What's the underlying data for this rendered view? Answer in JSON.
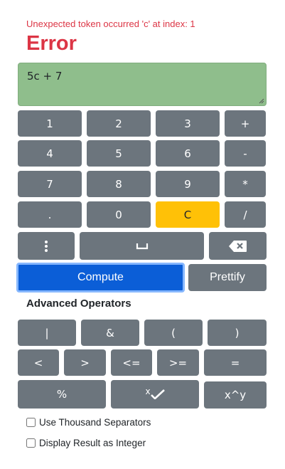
{
  "error": {
    "message": "Unexpected token occurred 'c' at index: 1",
    "title": "Error"
  },
  "expression": {
    "value": "5c + 7"
  },
  "keypad": {
    "row1": [
      "1",
      "2",
      "3",
      "+"
    ],
    "row2": [
      "4",
      "5",
      "6",
      "-"
    ],
    "row3": [
      "7",
      "8",
      "9",
      "*"
    ],
    "row4": [
      ".",
      "0",
      "C",
      "/"
    ],
    "row5_icons": [
      "more-vertical-icon",
      "space-bar-icon",
      "backspace-icon"
    ]
  },
  "actions": {
    "compute": "Compute",
    "prettify": "Prettify"
  },
  "advanced": {
    "title": "Advanced Operators",
    "row1": [
      "|",
      "&",
      "(",
      ")"
    ],
    "row2": [
      "<",
      ">",
      "<=",
      ">=",
      "="
    ],
    "row3": [
      "%",
      "x",
      "x^y"
    ],
    "root_icon": "root-check-icon"
  },
  "options": {
    "thousand_separators": {
      "label": "Use Thousand Separators",
      "checked": false
    },
    "integer_result": {
      "label": "Display Result as Integer",
      "checked": false
    }
  },
  "colors": {
    "error": "#dc3545",
    "expression_bg": "#8fbe8c",
    "key": "#6c757d",
    "clear": "#ffc107",
    "compute": "#0b5ed7"
  }
}
